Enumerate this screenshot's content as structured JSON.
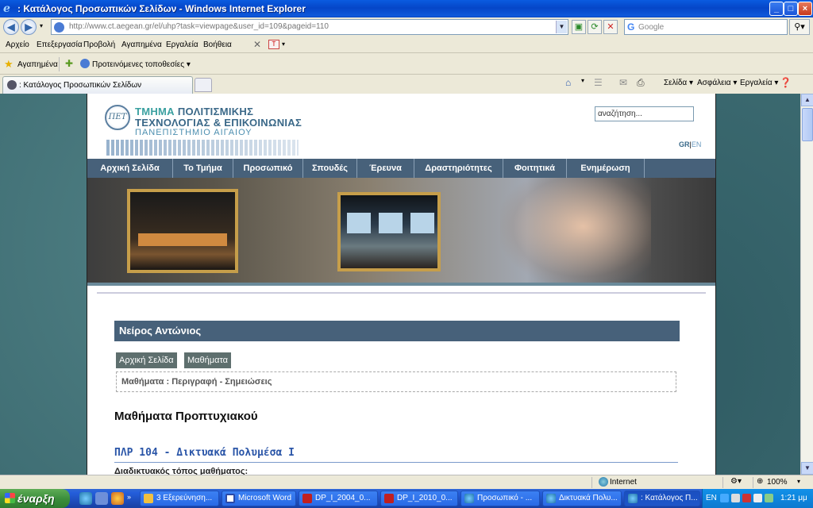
{
  "window": {
    "title": ": Κατάλογος Προσωπικών Σελίδων - Windows Internet Explorer",
    "minimize": "_",
    "maximize": "□",
    "close": "×"
  },
  "address_bar": {
    "url": "http://www.ct.aegean.gr/el/uhp?task=viewpage&user_id=109&pageid=110",
    "search_placeholder": "Google",
    "search_engine_letter": "G"
  },
  "menu": {
    "items": [
      "Αρχείο",
      "Επεξεργασία",
      "Προβολή",
      "Αγαπημένα",
      "Εργαλεία",
      "Βοήθεια"
    ]
  },
  "favorites_bar": {
    "favorites_label": "Αγαπημένα",
    "suggested_label": "Προτεινόμενες τοποθεσίες ▾"
  },
  "tabs": [
    {
      "label": ": Κατάλογος Προσωπικών Σελίδων"
    }
  ],
  "command_bar": {
    "page": "Σελίδα ▾",
    "safety": "Ασφάλεια ▾",
    "tools": "Εργαλεία ▾"
  },
  "site": {
    "logo_mark": "ΠΕΤ",
    "logo_line1_highlight": "ΤΜΗΜΑ",
    "logo_line1": "ΠΟΛΙΤΙΣΜΙΚΗΣ",
    "logo_line2": "ΤΕΧΝΟΛΟΓΙΑΣ & ΕΠΙΚΟΙΝΩΝΙΑΣ",
    "logo_line3": "ΠΑΝΕΠΙΣΤΗΜΙΟ ΑΙΓΑΙΟΥ",
    "search_value": "αναζήτηση...",
    "lang_gr": "GR",
    "lang_sep": "|",
    "lang_en": "EN",
    "nav": [
      "Αρχική Σελίδα",
      "Το Τμήμα",
      "Προσωπικό",
      "Σπουδές",
      "Έρευνα",
      "Δραστηριότητες",
      "Φοιτητικά",
      "Ενημέρωση"
    ],
    "person_name": "Νείρος Αντώνιος",
    "page_buttons": [
      "Αρχική Σελίδα",
      "Μαθήματα"
    ],
    "breadcrumb": "Μαθήματα : Περιγραφή - Σημειώσεις",
    "section_heading": "Μαθήματα Προπτυχιακού",
    "course_title": "ΠΛΡ 104 - Δικτυακά Πολυμέσα Ι",
    "course_site_label": "Διαδικτυακός τόπος μαθήματος:"
  },
  "status_bar": {
    "zone": "Internet",
    "zoom": "100%"
  },
  "taskbar": {
    "start_label": "έναρξη",
    "tasks": [
      "3 Εξερεύνηση...",
      "Microsoft Word",
      "DP_I_2004_0...",
      "DP_I_2010_0...",
      "Προσωπικό - ...",
      "Δικτυακά Πολυ...",
      ": Κατάλογος Π..."
    ],
    "language": "EN",
    "clock": "1:21 μμ"
  }
}
